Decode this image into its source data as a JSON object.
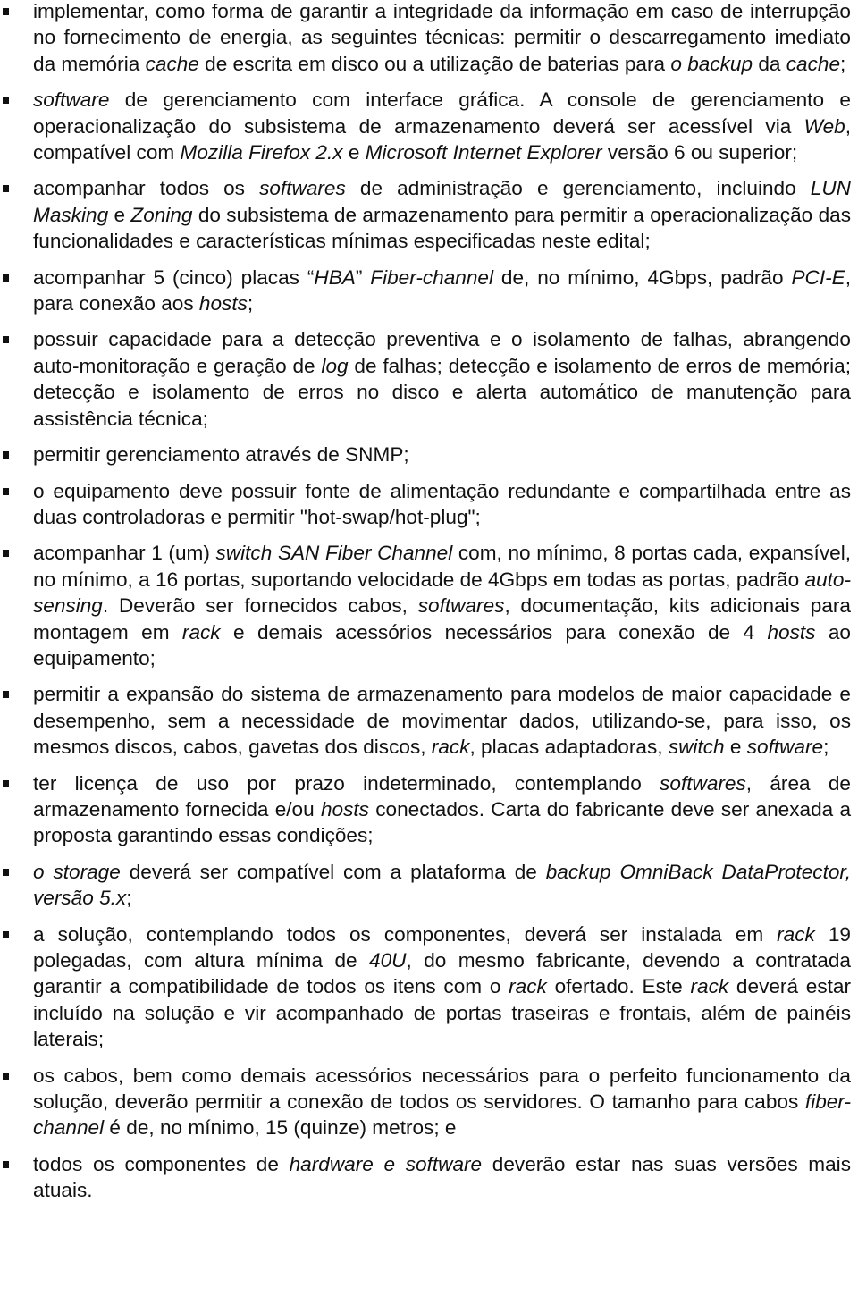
{
  "document": {
    "bullet_icon": "square-bullet",
    "items": [
      [
        {
          "t": "implementar, como forma de garantir a integridade da informação em caso de interrupção no fornecimento de energia, as seguintes técnicas: permitir o descarregamento imediato da memória "
        },
        {
          "t": "cache",
          "i": true
        },
        {
          "t": " de escrita em disco ou a utilização de baterias para "
        },
        {
          "t": "o backup",
          "i": true
        },
        {
          "t": " da "
        },
        {
          "t": "cache",
          "i": true
        },
        {
          "t": ";"
        }
      ],
      [
        {
          "t": "software",
          "i": true
        },
        {
          "t": " de gerenciamento com interface gráfica. A console de gerenciamento e operacionalização do subsistema de armazenamento deverá ser acessível via "
        },
        {
          "t": "Web",
          "i": true
        },
        {
          "t": ", compatível com "
        },
        {
          "t": "Mozilla Firefox 2.x",
          "i": true
        },
        {
          "t": " e "
        },
        {
          "t": "Microsoft Internet Explorer",
          "i": true
        },
        {
          "t": " versão 6 ou superior;"
        }
      ],
      [
        {
          "t": "acompanhar todos os "
        },
        {
          "t": "softwares",
          "i": true
        },
        {
          "t": " de administração e gerenciamento, incluindo "
        },
        {
          "t": "LUN Masking",
          "i": true
        },
        {
          "t": " e "
        },
        {
          "t": "Zoning",
          "i": true
        },
        {
          "t": " do subsistema de armazenamento para permitir a operacionalização das funcionalidades e características mínimas especificadas neste edital;"
        }
      ],
      [
        {
          "t": "acompanhar 5 (cinco) placas “"
        },
        {
          "t": "HBA",
          "i": true
        },
        {
          "t": "” "
        },
        {
          "t": "Fiber-channel",
          "i": true
        },
        {
          "t": " de, no mínimo, 4Gbps, padrão "
        },
        {
          "t": "PCI-E",
          "i": true
        },
        {
          "t": ", para conexão aos "
        },
        {
          "t": "hosts",
          "i": true
        },
        {
          "t": ";"
        }
      ],
      [
        {
          "t": "possuir capacidade para a detecção preventiva e o isolamento de falhas, abrangendo auto-monitoração e geração de "
        },
        {
          "t": "log",
          "i": true
        },
        {
          "t": " de falhas; detecção e isolamento de erros de memória; detecção e isolamento de erros no disco e alerta automático de manutenção para assistência técnica;"
        }
      ],
      [
        {
          "t": "permitir gerenciamento através de SNMP;"
        }
      ],
      [
        {
          "t": "o equipamento deve possuir fonte de alimentação redundante e compartilhada entre as duas controladoras e permitir \"hot-swap/hot-plug\";"
        }
      ],
      [
        {
          "t": "acompanhar 1 (um) "
        },
        {
          "t": "switch SAN Fiber Channel",
          "i": true
        },
        {
          "t": " com, no mínimo, 8 portas cada, expansível, no mínimo, a 16 portas, suportando velocidade de 4Gbps em todas as portas, padrão "
        },
        {
          "t": "auto-sensing",
          "i": true
        },
        {
          "t": ". Deverão ser fornecidos cabos, "
        },
        {
          "t": "softwares",
          "i": true
        },
        {
          "t": ", documentação, kits adicionais para montagem em "
        },
        {
          "t": "rack",
          "i": true
        },
        {
          "t": " e demais acessórios necessários para conexão de 4 "
        },
        {
          "t": "hosts",
          "i": true
        },
        {
          "t": " ao equipamento;"
        }
      ],
      [
        {
          "t": "permitir a expansão do sistema de armazenamento para modelos de maior capacidade e desempenho, sem a necessidade de movimentar dados, utilizando-se, para isso, os mesmos discos, cabos, gavetas dos discos, "
        },
        {
          "t": "rack",
          "i": true
        },
        {
          "t": ", placas adaptadoras, "
        },
        {
          "t": "switch",
          "i": true
        },
        {
          "t": " e  "
        },
        {
          "t": "software",
          "i": true
        },
        {
          "t": ";"
        }
      ],
      [
        {
          "t": "ter licença de uso por prazo indeterminado, contemplando "
        },
        {
          "t": "softwares",
          "i": true
        },
        {
          "t": ", área de armazenamento fornecida e/ou "
        },
        {
          "t": "hosts",
          "i": true
        },
        {
          "t": " conectados. Carta do fabricante deve ser anexada a proposta garantindo essas condições;"
        }
      ],
      [
        {
          "t": "o storage",
          "i": true
        },
        {
          "t": " deverá ser compatível com a plataforma de "
        },
        {
          "t": "backup OmniBack DataProtector, versão 5.x",
          "i": true
        },
        {
          "t": ";"
        }
      ],
      [
        {
          "t": "a solução, contemplando todos os componentes, deverá ser instalada em "
        },
        {
          "t": "rack",
          "i": true
        },
        {
          "t": " 19 polegadas, com altura mínima de "
        },
        {
          "t": "40U",
          "i": true
        },
        {
          "t": ", do mesmo fabricante, devendo a contratada garantir a compatibilidade de todos os itens com o "
        },
        {
          "t": "rack",
          "i": true
        },
        {
          "t": " ofertado. Este "
        },
        {
          "t": "rack",
          "i": true
        },
        {
          "t": " deverá estar incluído na solução e vir acompanhado de portas traseiras e frontais, além de painéis laterais;"
        }
      ],
      [
        {
          "t": "os cabos, bem como demais acessórios necessários para o perfeito funcionamento da solução, deverão permitir a conexão de todos os servidores. O tamanho para cabos "
        },
        {
          "t": "fiber-channel",
          "i": true
        },
        {
          "t": " é de, no mínimo, 15 (quinze) metros; e"
        }
      ],
      [
        {
          "t": "todos os componentes de "
        },
        {
          "t": "hardware e software",
          "i": true
        },
        {
          "t": " deverão estar nas suas versões mais atuais."
        }
      ]
    ]
  }
}
